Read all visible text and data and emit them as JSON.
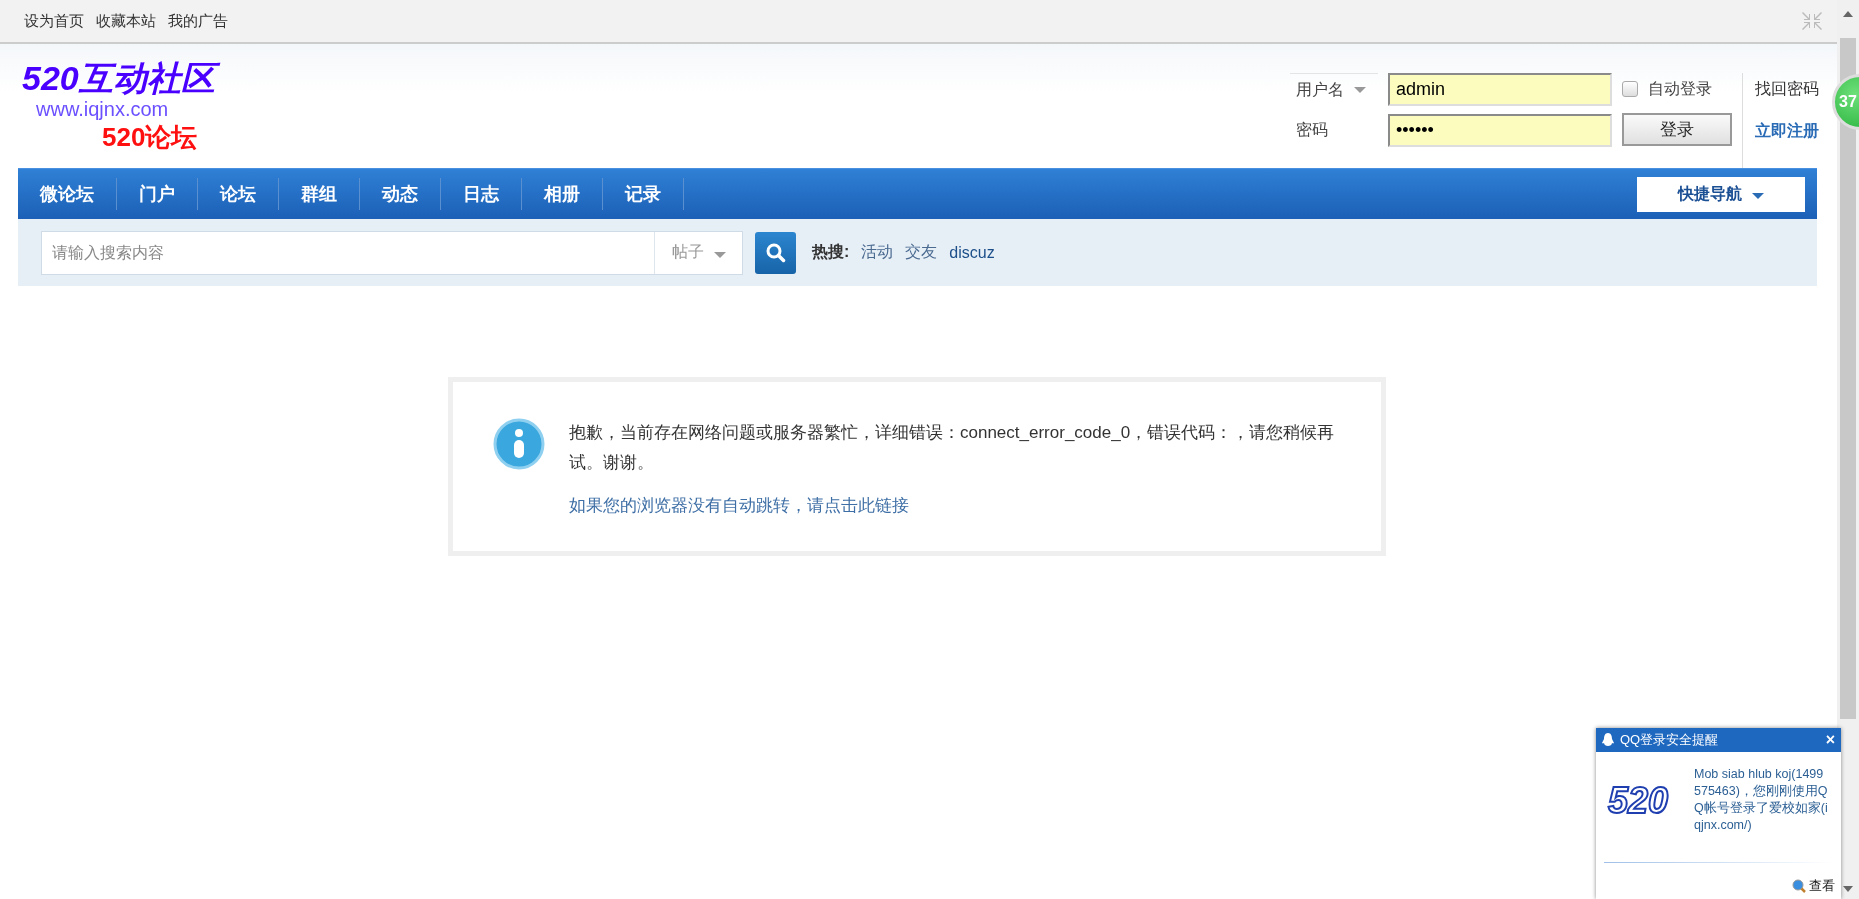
{
  "top_bar": {
    "links": [
      "设为首页",
      "收藏本站",
      "我的广告"
    ]
  },
  "logo": {
    "title": "520互动社区",
    "url": "www.iqjnx.com",
    "subtitle": "520论坛"
  },
  "login": {
    "username_label": "用户名",
    "username": "admin",
    "password_label": "密码",
    "password": "••••••",
    "auto_login": {
      "label": "自动登录",
      "checked": false
    },
    "login_button": "登录",
    "forgot": "找回密码",
    "register": "立即注册"
  },
  "nav": {
    "items": [
      "微论坛",
      "门户",
      "论坛",
      "群组",
      "动态",
      "日志",
      "相册",
      "记录"
    ],
    "quick_nav": "快捷导航"
  },
  "search": {
    "placeholder": "请输入搜索内容",
    "type": "帖子",
    "hot_label": "热搜:",
    "hot": [
      "活动",
      "交友",
      "discuz"
    ]
  },
  "message": {
    "text": "抱歉，当前存在网络问题或服务器繁忙，详细错误：connect_error_code_0，错误代码：，请您稍候再试。谢谢。",
    "link": "如果您的浏览器没有自动跳转，请点击此链接"
  },
  "badge": "37",
  "qq_popup": {
    "title": "QQ登录安全提醒",
    "close": "×",
    "logo": "520",
    "text": "Mob siab hlub koj(1499575463)，您刚刚使用QQ帐号登录了爱校如家(iqjnx.com/)",
    "view": "查看"
  }
}
